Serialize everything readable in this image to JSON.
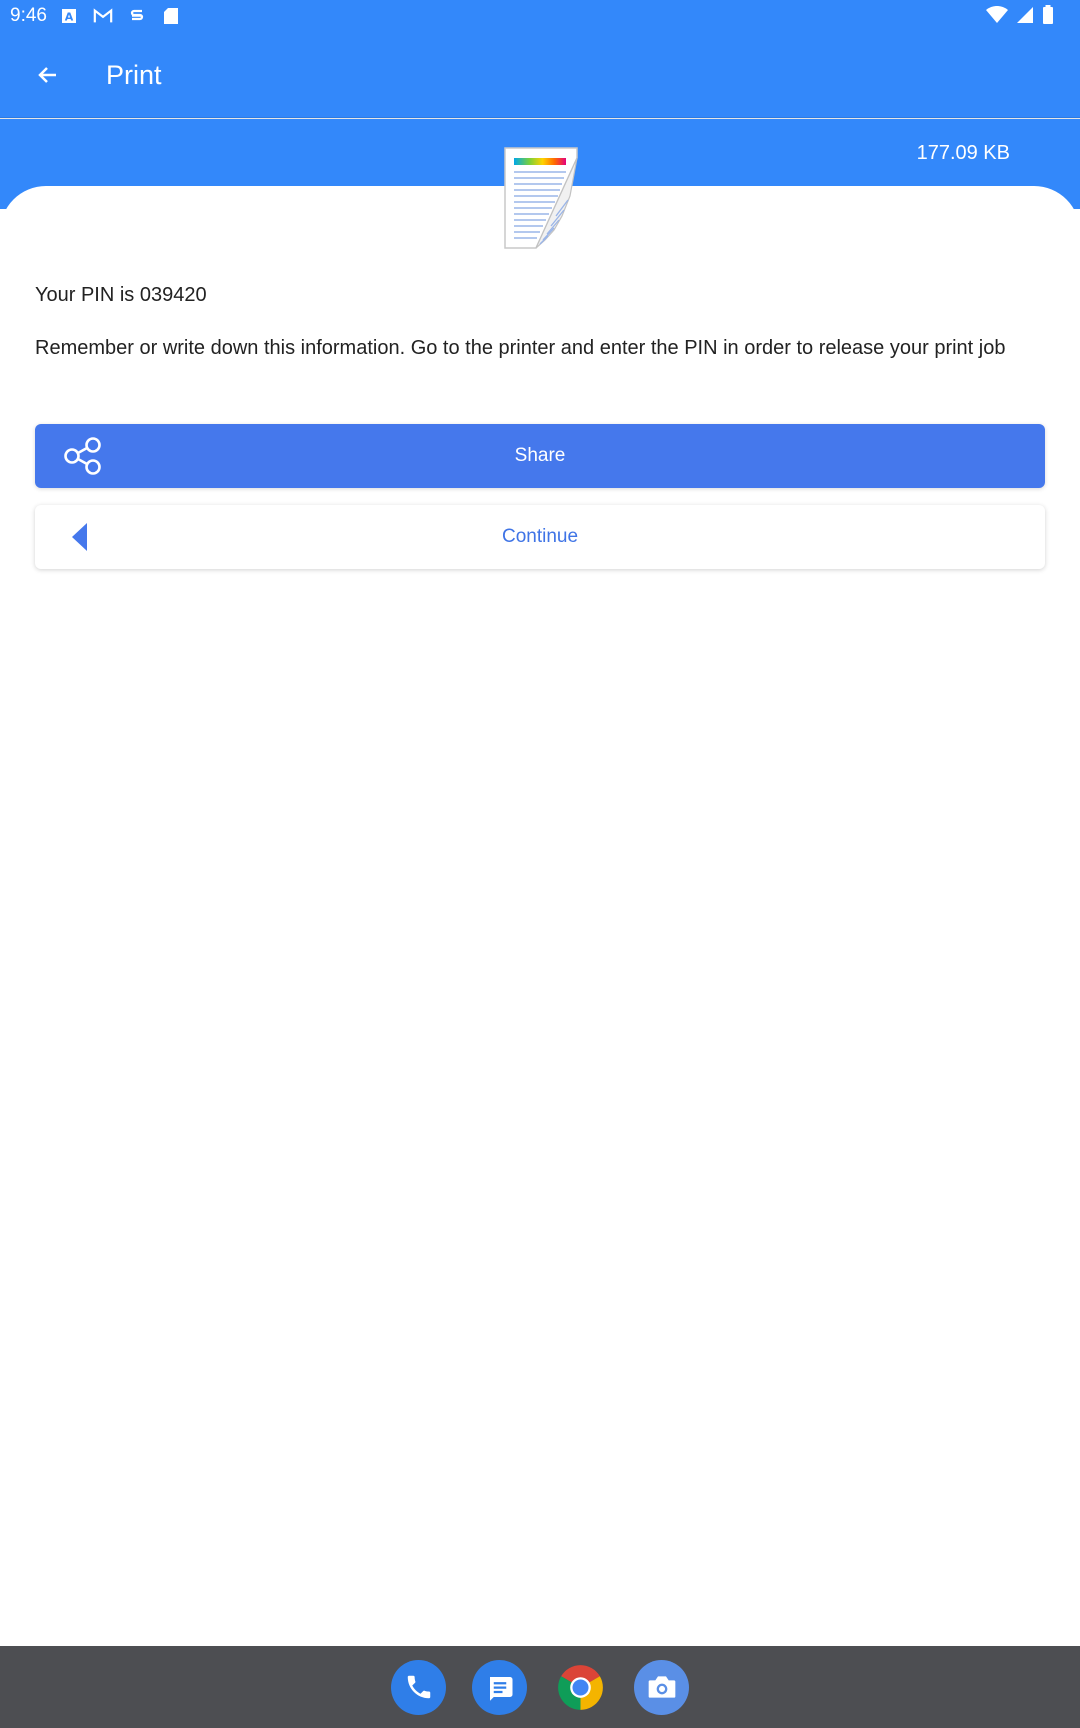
{
  "status_bar": {
    "time": "9:46",
    "left_icons": [
      "a-notification-icon",
      "gmail-icon",
      "app-notification-icon",
      "sd-card-icon"
    ],
    "right_icons": [
      "wifi-icon",
      "cell-signal-icon",
      "battery-icon"
    ]
  },
  "app_bar": {
    "title": "Print",
    "back_icon": "arrow-back-icon"
  },
  "header": {
    "file_size": "177.09 KB"
  },
  "content": {
    "pin_text": "Your PIN is 039420",
    "info_text": "Remember or write down this information. Go to the printer and enter the PIN in order to release your print job"
  },
  "buttons": {
    "share_label": "Share",
    "continue_label": "Continue"
  },
  "dock": {
    "apps": [
      "phone-app-icon",
      "messages-app-icon",
      "chrome-app-icon",
      "camera-app-icon"
    ]
  },
  "colors": {
    "primary": "#3388fa",
    "button": "#4578ec",
    "button_text_alt": "#3f74e6",
    "nav_bar": "#4d4e52"
  }
}
